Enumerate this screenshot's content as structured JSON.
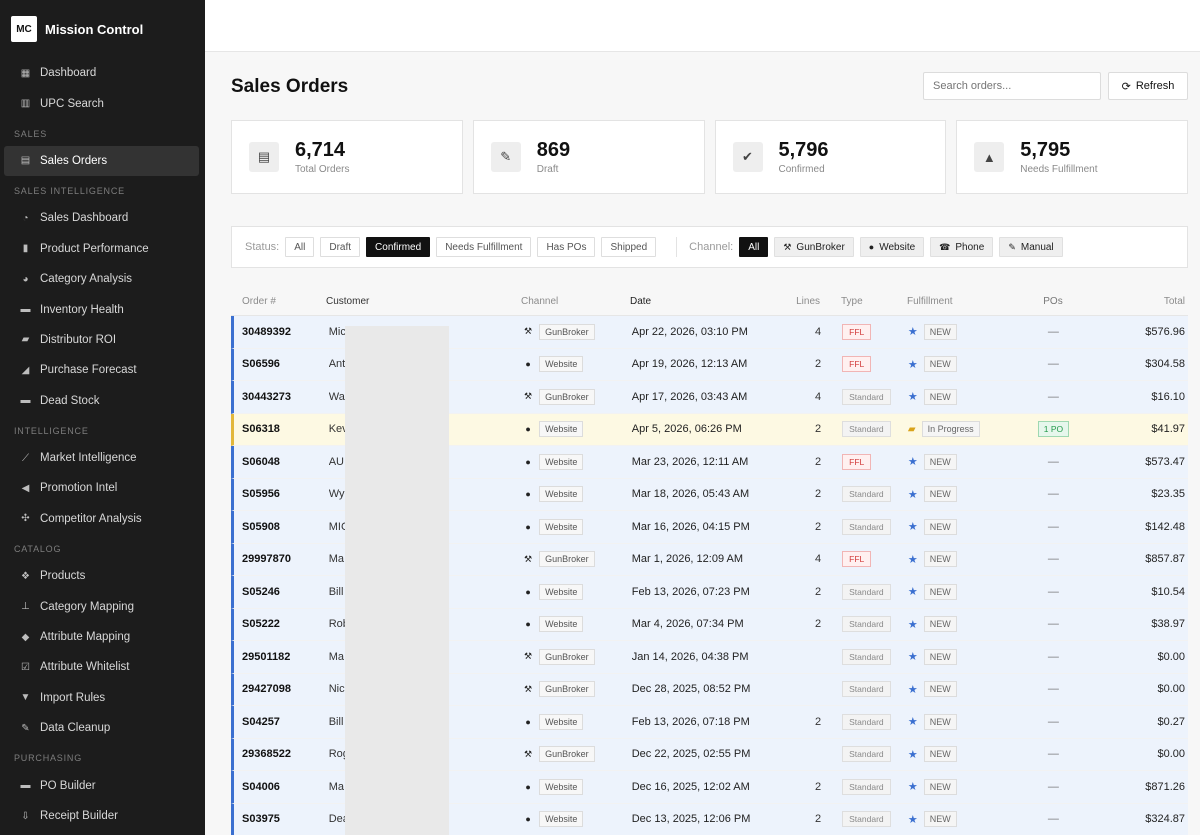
{
  "brand": {
    "logo": "MC",
    "name": "Mission Control"
  },
  "sidebar": {
    "top": [
      {
        "label": "Dashboard",
        "icon": "dashboard-icon",
        "glyph": "▦"
      },
      {
        "label": "UPC Search",
        "icon": "barcode-icon",
        "glyph": "▥"
      }
    ],
    "sections": [
      {
        "title": "SALES",
        "items": [
          {
            "label": "Sales Orders",
            "icon": "file-icon",
            "glyph": "▤",
            "active": true
          }
        ]
      },
      {
        "title": "SALES INTELLIGENCE",
        "items": [
          {
            "label": "Sales Dashboard",
            "icon": "gauge-icon",
            "glyph": "◔"
          },
          {
            "label": "Product Performance",
            "icon": "bar-chart-icon",
            "glyph": "▮"
          },
          {
            "label": "Category Analysis",
            "icon": "pie-chart-icon",
            "glyph": "◕"
          },
          {
            "label": "Inventory Health",
            "icon": "box-icon",
            "glyph": "▬"
          },
          {
            "label": "Distributor ROI",
            "icon": "truck-icon",
            "glyph": "▰"
          },
          {
            "label": "Purchase Forecast",
            "icon": "area-chart-icon",
            "glyph": "◢"
          },
          {
            "label": "Dead Stock",
            "icon": "archive-icon",
            "glyph": "▬"
          }
        ]
      },
      {
        "title": "INTELLIGENCE",
        "items": [
          {
            "label": "Market Intelligence",
            "icon": "line-chart-icon",
            "glyph": "⟋"
          },
          {
            "label": "Promotion Intel",
            "icon": "bullhorn-icon",
            "glyph": "◀"
          },
          {
            "label": "Competitor Analysis",
            "icon": "crosshair-icon",
            "glyph": "✣"
          }
        ]
      },
      {
        "title": "CATALOG",
        "items": [
          {
            "label": "Products",
            "icon": "cubes-icon",
            "glyph": "❖"
          },
          {
            "label": "Category Mapping",
            "icon": "sitemap-icon",
            "glyph": "⊥"
          },
          {
            "label": "Attribute Mapping",
            "icon": "tag-icon",
            "glyph": "◆"
          },
          {
            "label": "Attribute Whitelist",
            "icon": "check-square-icon",
            "glyph": "☑"
          },
          {
            "label": "Import Rules",
            "icon": "filter-icon",
            "glyph": "▼"
          },
          {
            "label": "Data Cleanup",
            "icon": "wrench-icon",
            "glyph": "✎"
          }
        ]
      },
      {
        "title": "PURCHASING",
        "items": [
          {
            "label": "PO Builder",
            "icon": "cart-icon",
            "glyph": "▬"
          },
          {
            "label": "Receipt Builder",
            "icon": "download-icon",
            "glyph": "⇩"
          }
        ]
      }
    ]
  },
  "page": {
    "title": "Sales Orders"
  },
  "search": {
    "placeholder": "Search orders..."
  },
  "refresh": {
    "label": "Refresh"
  },
  "stats": [
    {
      "value": "6,714",
      "label": "Total Orders",
      "icon": "document-icon",
      "glyph": "▤"
    },
    {
      "value": "869",
      "label": "Draft",
      "icon": "pencil-icon",
      "glyph": "✎"
    },
    {
      "value": "5,796",
      "label": "Confirmed",
      "icon": "check-circle-icon",
      "glyph": "✔"
    },
    {
      "value": "5,795",
      "label": "Needs Fulfillment",
      "icon": "warning-icon",
      "glyph": "▲"
    }
  ],
  "filters": {
    "status_label": "Status:",
    "status": [
      {
        "label": "All",
        "on": false
      },
      {
        "label": "Draft",
        "on": false
      },
      {
        "label": "Confirmed",
        "on": true
      },
      {
        "label": "Needs Fulfillment",
        "on": false
      },
      {
        "label": "Has POs",
        "on": false
      },
      {
        "label": "Shipped",
        "on": false
      }
    ],
    "channel_label": "Channel:",
    "channel": [
      {
        "label": "All",
        "on": true,
        "icon": "",
        "glyph": ""
      },
      {
        "label": "GunBroker",
        "on": false,
        "icon": "gavel-icon",
        "glyph": "⚒"
      },
      {
        "label": "Website",
        "on": false,
        "icon": "globe-icon",
        "glyph": "●"
      },
      {
        "label": "Phone",
        "on": false,
        "icon": "phone-icon",
        "glyph": "☎"
      },
      {
        "label": "Manual",
        "on": false,
        "icon": "pencil-icon",
        "glyph": "✎"
      }
    ]
  },
  "table": {
    "headers": {
      "order": "Order #",
      "customer": "Customer",
      "channel": "Channel",
      "date": "Date",
      "lines": "Lines",
      "type": "Type",
      "fulfillment": "Fulfillment",
      "pos": "POs",
      "total": "Total"
    },
    "rows": [
      {
        "order": "30489392",
        "customer": "Mic",
        "channel": "GunBroker",
        "date": "Apr 22, 2026, 03:10 PM",
        "lines": "4",
        "type": "FFL",
        "fulfillment": "NEW",
        "pos": "—",
        "total": "$576.96"
      },
      {
        "order": "S06596",
        "customer": "Ant",
        "channel": "Website",
        "date": "Apr 19, 2026, 12:13 AM",
        "lines": "2",
        "type": "FFL",
        "fulfillment": "NEW",
        "pos": "—",
        "total": "$304.58"
      },
      {
        "order": "30443273",
        "customer": "Wa",
        "channel": "GunBroker",
        "date": "Apr 17, 2026, 03:43 AM",
        "lines": "4",
        "type": "Standard",
        "fulfillment": "NEW",
        "pos": "—",
        "total": "$16.10"
      },
      {
        "order": "S06318",
        "customer": "Kev",
        "channel": "Website",
        "date": "Apr 5, 2026, 06:26 PM",
        "lines": "2",
        "type": "Standard",
        "fulfillment": "In Progress",
        "pos": "1 PO",
        "total": "$41.97"
      },
      {
        "order": "S06048",
        "customer": "AU",
        "channel": "Website",
        "date": "Mar 23, 2026, 12:11 AM",
        "lines": "2",
        "type": "FFL",
        "fulfillment": "NEW",
        "pos": "—",
        "total": "$573.47"
      },
      {
        "order": "S05956",
        "customer": "Wy",
        "channel": "Website",
        "date": "Mar 18, 2026, 05:43 AM",
        "lines": "2",
        "type": "Standard",
        "fulfillment": "NEW",
        "pos": "—",
        "total": "$23.35"
      },
      {
        "order": "S05908",
        "customer": "MIC",
        "channel": "Website",
        "date": "Mar 16, 2026, 04:15 PM",
        "lines": "2",
        "type": "Standard",
        "fulfillment": "NEW",
        "pos": "—",
        "total": "$142.48"
      },
      {
        "order": "29997870",
        "customer": "Ma",
        "channel": "GunBroker",
        "date": "Mar 1, 2026, 12:09 AM",
        "lines": "4",
        "type": "FFL",
        "fulfillment": "NEW",
        "pos": "—",
        "total": "$857.87"
      },
      {
        "order": "S05246",
        "customer": "Bill",
        "channel": "Website",
        "date": "Feb 13, 2026, 07:23 PM",
        "lines": "2",
        "type": "Standard",
        "fulfillment": "NEW",
        "pos": "—",
        "total": "$10.54"
      },
      {
        "order": "S05222",
        "customer": "Rob",
        "channel": "Website",
        "date": "Mar 4, 2026, 07:34 PM",
        "lines": "2",
        "type": "Standard",
        "fulfillment": "NEW",
        "pos": "—",
        "total": "$38.97"
      },
      {
        "order": "29501182",
        "customer": "Ma",
        "channel": "GunBroker",
        "date": "Jan 14, 2026, 04:38 PM",
        "lines": "",
        "type": "Standard",
        "fulfillment": "NEW",
        "pos": "—",
        "total": "$0.00"
      },
      {
        "order": "29427098",
        "customer": "Nic",
        "channel": "GunBroker",
        "date": "Dec 28, 2025, 08:52 PM",
        "lines": "",
        "type": "Standard",
        "fulfillment": "NEW",
        "pos": "—",
        "total": "$0.00"
      },
      {
        "order": "S04257",
        "customer": "Bill",
        "channel": "Website",
        "date": "Feb 13, 2026, 07:18 PM",
        "lines": "2",
        "type": "Standard",
        "fulfillment": "NEW",
        "pos": "—",
        "total": "$0.27"
      },
      {
        "order": "29368522",
        "customer": "Rog",
        "channel": "GunBroker",
        "date": "Dec 22, 2025, 02:55 PM",
        "lines": "",
        "type": "Standard",
        "fulfillment": "NEW",
        "pos": "—",
        "total": "$0.00"
      },
      {
        "order": "S04006",
        "customer": "Ma",
        "channel": "Website",
        "date": "Dec 16, 2025, 12:02 AM",
        "lines": "2",
        "type": "Standard",
        "fulfillment": "NEW",
        "pos": "—",
        "total": "$871.26"
      },
      {
        "order": "S03975",
        "customer": "Dea",
        "channel": "Website",
        "date": "Dec 13, 2025, 12:06 PM",
        "lines": "2",
        "type": "Standard",
        "fulfillment": "NEW",
        "pos": "—",
        "total": "$324.87"
      }
    ]
  },
  "colors": {
    "sidebar_bg": "#1c1c1c",
    "row_highlight": "#edf3fc",
    "row_accent": "#3a6fd0",
    "progress_row": "#fdf9e3",
    "ffl_red": "#d23b3b",
    "po_green": "#239a4a"
  }
}
